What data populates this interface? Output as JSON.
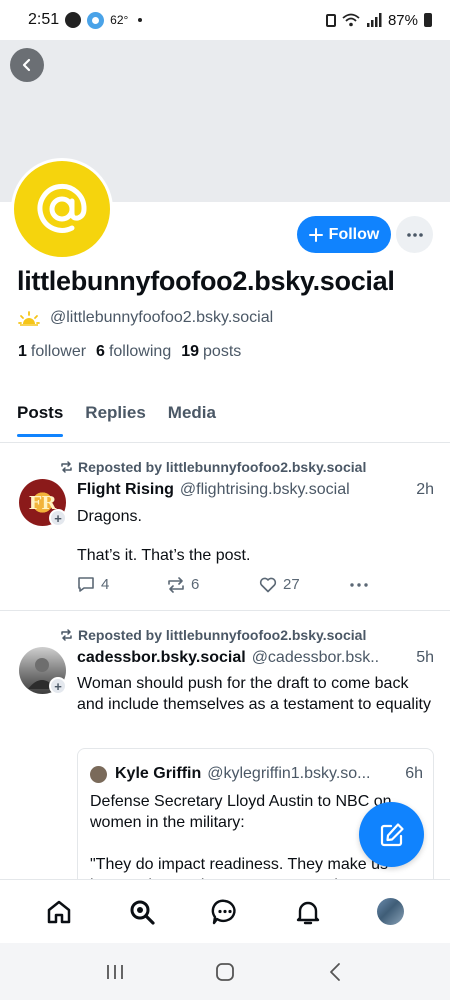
{
  "status_bar": {
    "time": "2:51",
    "temperature": "62°",
    "battery": "87%"
  },
  "profile": {
    "display_name": "littlebunnyfoofoo2.bsky.social",
    "handle": "@littlebunnyfoofoo2.bsky.social",
    "avatar_icon": "at-sign-icon",
    "avatar_color": "#f5d40d",
    "follow_label": "Follow",
    "followers_count": "1",
    "followers_label": "follower",
    "following_count": "6",
    "following_label": "following",
    "posts_count": "19",
    "posts_label": "posts"
  },
  "tabs": [
    {
      "label": "Posts",
      "active": true
    },
    {
      "label": "Replies",
      "active": false
    },
    {
      "label": "Media",
      "active": false
    }
  ],
  "posts": [
    {
      "repost_label": "Reposted by littlebunnyfoofoo2.bsky.social",
      "author": "Flight Rising",
      "handle": "@flightrising.bsky.social",
      "time": "2h",
      "text_line1": "Dragons.",
      "text_line2": "That’s it. That’s the post.",
      "replies": "4",
      "reposts": "6",
      "likes": "27"
    },
    {
      "repost_label": "Reposted by littlebunnyfoofoo2.bsky.social",
      "author": "cadessbor.bsky.social",
      "handle": "@cadessbor.bsk..",
      "time": "5h",
      "text": "Woman should push for the draft to come back and include themselves as a testament to equality",
      "quote": {
        "author": "Kyle Griffin",
        "handle": "@kylegriffin1.bsky.so...",
        "time": "6h",
        "text": "Defense Secretary Lloyd Austin to NBC on women in the military:\n\n\"They do impact readiness. They make us better. They make us stronger. And"
      }
    }
  ],
  "accent_color": "#1083fe"
}
